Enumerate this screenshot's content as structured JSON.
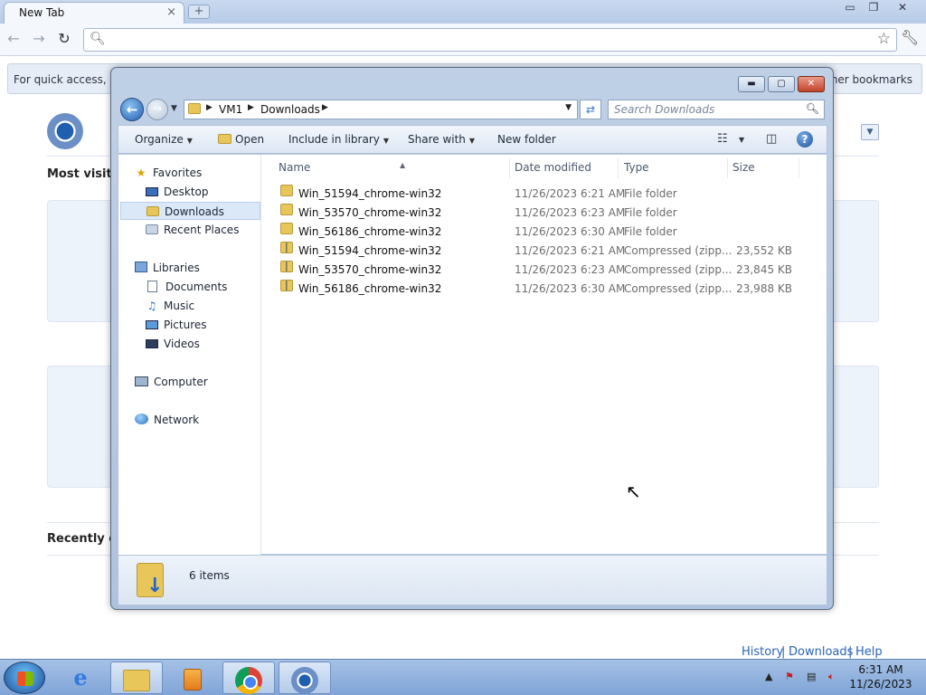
{
  "chrome": {
    "tab_title": "New Tab",
    "tab_close": "×",
    "new_tab": "+",
    "window_controls": {
      "minimize": "▭",
      "restore": "❐",
      "close": "✕"
    },
    "back": "←",
    "forward": "→",
    "reload": "↻",
    "search_icon": "search-icon",
    "omnibox_value": "",
    "bookmarks_hint": "For quick access, pla",
    "other_bookmarks": "Other bookmarks",
    "most_visited": "Most visited",
    "recently_closed": "Recently cl",
    "footer": {
      "history": "History",
      "downloads": "Downloads",
      "help": "Help",
      "separator": "|"
    }
  },
  "explorer": {
    "controls": {
      "minimize": "▬",
      "maximize": "▢",
      "close": "✕"
    },
    "breadcrumb": [
      "VM1",
      "Downloads"
    ],
    "search_placeholder": "Search Downloads",
    "commands": {
      "organize": "Organize",
      "open": "Open",
      "include_in_library": "Include in library",
      "share_with": "Share with",
      "new_folder": "New folder",
      "help": "?"
    },
    "nav": {
      "favorites": "Favorites",
      "desktop": "Desktop",
      "downloads": "Downloads",
      "recent_places": "Recent Places",
      "libraries": "Libraries",
      "documents": "Documents",
      "music": "Music",
      "pictures": "Pictures",
      "videos": "Videos",
      "computer": "Computer",
      "network": "Network"
    },
    "columns": {
      "name": "Name",
      "date_modified": "Date modified",
      "type": "Type",
      "size": "Size"
    },
    "files": [
      {
        "name": "Win_51594_chrome-win32",
        "date": "11/26/2023 6:21 AM",
        "type": "File folder",
        "size": "",
        "kind": "folder"
      },
      {
        "name": "Win_53570_chrome-win32",
        "date": "11/26/2023 6:23 AM",
        "type": "File folder",
        "size": "",
        "kind": "folder"
      },
      {
        "name": "Win_56186_chrome-win32",
        "date": "11/26/2023 6:30 AM",
        "type": "File folder",
        "size": "",
        "kind": "folder"
      },
      {
        "name": "Win_51594_chrome-win32",
        "date": "11/26/2023 6:21 AM",
        "type": "Compressed (zipp...",
        "size": "23,552 KB",
        "kind": "zip"
      },
      {
        "name": "Win_53570_chrome-win32",
        "date": "11/26/2023 6:23 AM",
        "type": "Compressed (zipp...",
        "size": "23,845 KB",
        "kind": "zip"
      },
      {
        "name": "Win_56186_chrome-win32",
        "date": "11/26/2023 6:30 AM",
        "type": "Compressed (zipp...",
        "size": "23,988 KB",
        "kind": "zip"
      }
    ],
    "status": "6 items"
  },
  "taskbar": {
    "apps": [
      "internet-explorer",
      "windows-explorer",
      "windows-media-player",
      "google-chrome",
      "chromium"
    ],
    "clock_time": "6:31 AM",
    "clock_date": "11/26/2023"
  }
}
